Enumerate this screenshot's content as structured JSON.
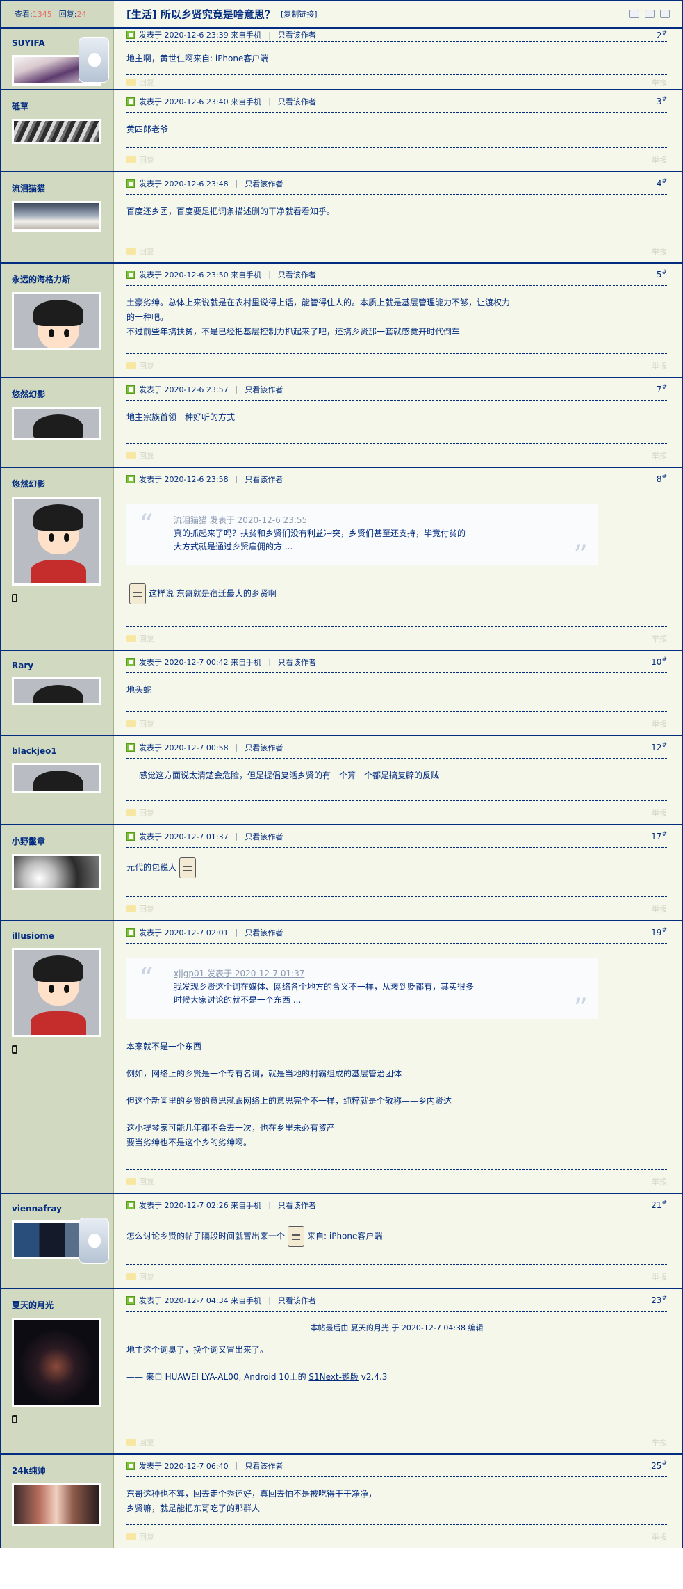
{
  "header": {
    "views_label": "查看:",
    "views": "1345",
    "replies_label": "回复:",
    "replies": "24",
    "title": "[生活] 所以乡贤究竟是啥意思？",
    "copy_link": "[复制链接]"
  },
  "labels": {
    "only_author": "只看该作者",
    "reply": "回复",
    "report": "举报"
  },
  "posts": [
    {
      "user": "SUYIFA",
      "time": "发表于 2020-12-6 23:39 来自手机",
      "floor": "2",
      "body": "地主啊，黄世仁啊来自: iPhone客户端"
    },
    {
      "user": "砥草",
      "time": "发表于 2020-12-6 23:40 来自手机",
      "floor": "3",
      "body": "黄四郎老爷"
    },
    {
      "user": "流泪猫猫",
      "time": "发表于 2020-12-6 23:48",
      "floor": "4",
      "body": "百度还乡团，百度要是把词条描述删的干净就看看知乎。"
    },
    {
      "user": "永远的海格力斯",
      "time": "发表于 2020-12-6 23:50 来自手机",
      "floor": "5",
      "body": "土豪劣绅。总体上来说就是在农村里说得上话，能管得住人的。本质上就是基层管理能力不够，让渡权力\n的一种吧。\n不过前些年搞扶贫，不是已经把基层控制力抓起来了吧，还搞乡贤那一套就感觉开时代倒车"
    },
    {
      "user": "悠然幻影",
      "time": "发表于 2020-12-6 23:57",
      "floor": "7",
      "body": "地主宗族首领一种好听的方式"
    },
    {
      "user": "悠然幻影",
      "time": "发表于 2020-12-6 23:58",
      "floor": "8",
      "quote_head": "流泪猫猫 发表于 2020-12-6 23:55",
      "quote_body": "真的抓起来了吗？扶贫和乡贤们没有利益冲突，乡贤们甚至还支持，毕竟付贫的一\n大方式就是通过乡贤雇佣的方 ...",
      "body": "这样说 东哥就是宿迁最大的乡贤啊"
    },
    {
      "user": "Rary",
      "time": "发表于 2020-12-7 00:42 来自手机",
      "floor": "10",
      "body": "地头蛇"
    },
    {
      "user": "blackjeo1",
      "time": "发表于 2020-12-7 00:58",
      "floor": "12",
      "body": "感觉这方面说太清楚会危险，但是提倡复活乡贤的有一个算一个都是搞复辟的反贼"
    },
    {
      "user": "小野鬣章",
      "time": "发表于 2020-12-7 01:37",
      "floor": "17",
      "body": "元代的包税人"
    },
    {
      "user": "illusiome",
      "time": "发表于 2020-12-7 02:01",
      "floor": "19",
      "quote_head": "xjjgp01 发表于 2020-12-7 01:37",
      "quote_body": "我发现乡贤这个词在媒体、网络各个地方的含义不一样，从褒到贬都有，其实很多\n时候大家讨论的就不是一个东西 ...",
      "paras": [
        "本来就不是一个东西",
        "例如，网络上的乡贤是一个专有名词，就是当地的村霸组成的基层管治团体",
        "但这个新闻里的乡贤的意思就跟网络上的意思完全不一样，纯粹就是个敬称——乡内贤达",
        "这小提琴家可能几年都不会去一次，也在乡里未必有资产\n要当劣绅也不是这个乡的劣绅啊。"
      ]
    },
    {
      "user": "viennafray",
      "time": "发表于 2020-12-7 02:26 来自手机",
      "floor": "21",
      "body": "怎么讨论乡贤的帖子隔段时间就冒出来一个",
      "body_suffix": "来自: iPhone客户端"
    },
    {
      "user": "夏天的月光",
      "time": "发表于 2020-12-7 04:34 来自手机",
      "floor": "23",
      "edit_note": "本帖最后由 夏天的月光 于 2020-12-7 04:38 编辑",
      "body": "地主这个词臭了，换个词又冒出来了。",
      "sig_prefix": "—— 来自 HUAWEI LYA-AL00, Android 10上的 ",
      "sig_link": "S1Next-鹅版",
      "sig_suffix": " v2.4.3"
    },
    {
      "user": "24k纯帅",
      "time": "发表于 2020-12-7 06:40",
      "floor": "25",
      "body": "东哥这种也不算，回去走个秀还好，真回去怕不是被吃得干干净净，\n乡贤嘛，就是能把东哥吃了的那群人"
    }
  ]
}
